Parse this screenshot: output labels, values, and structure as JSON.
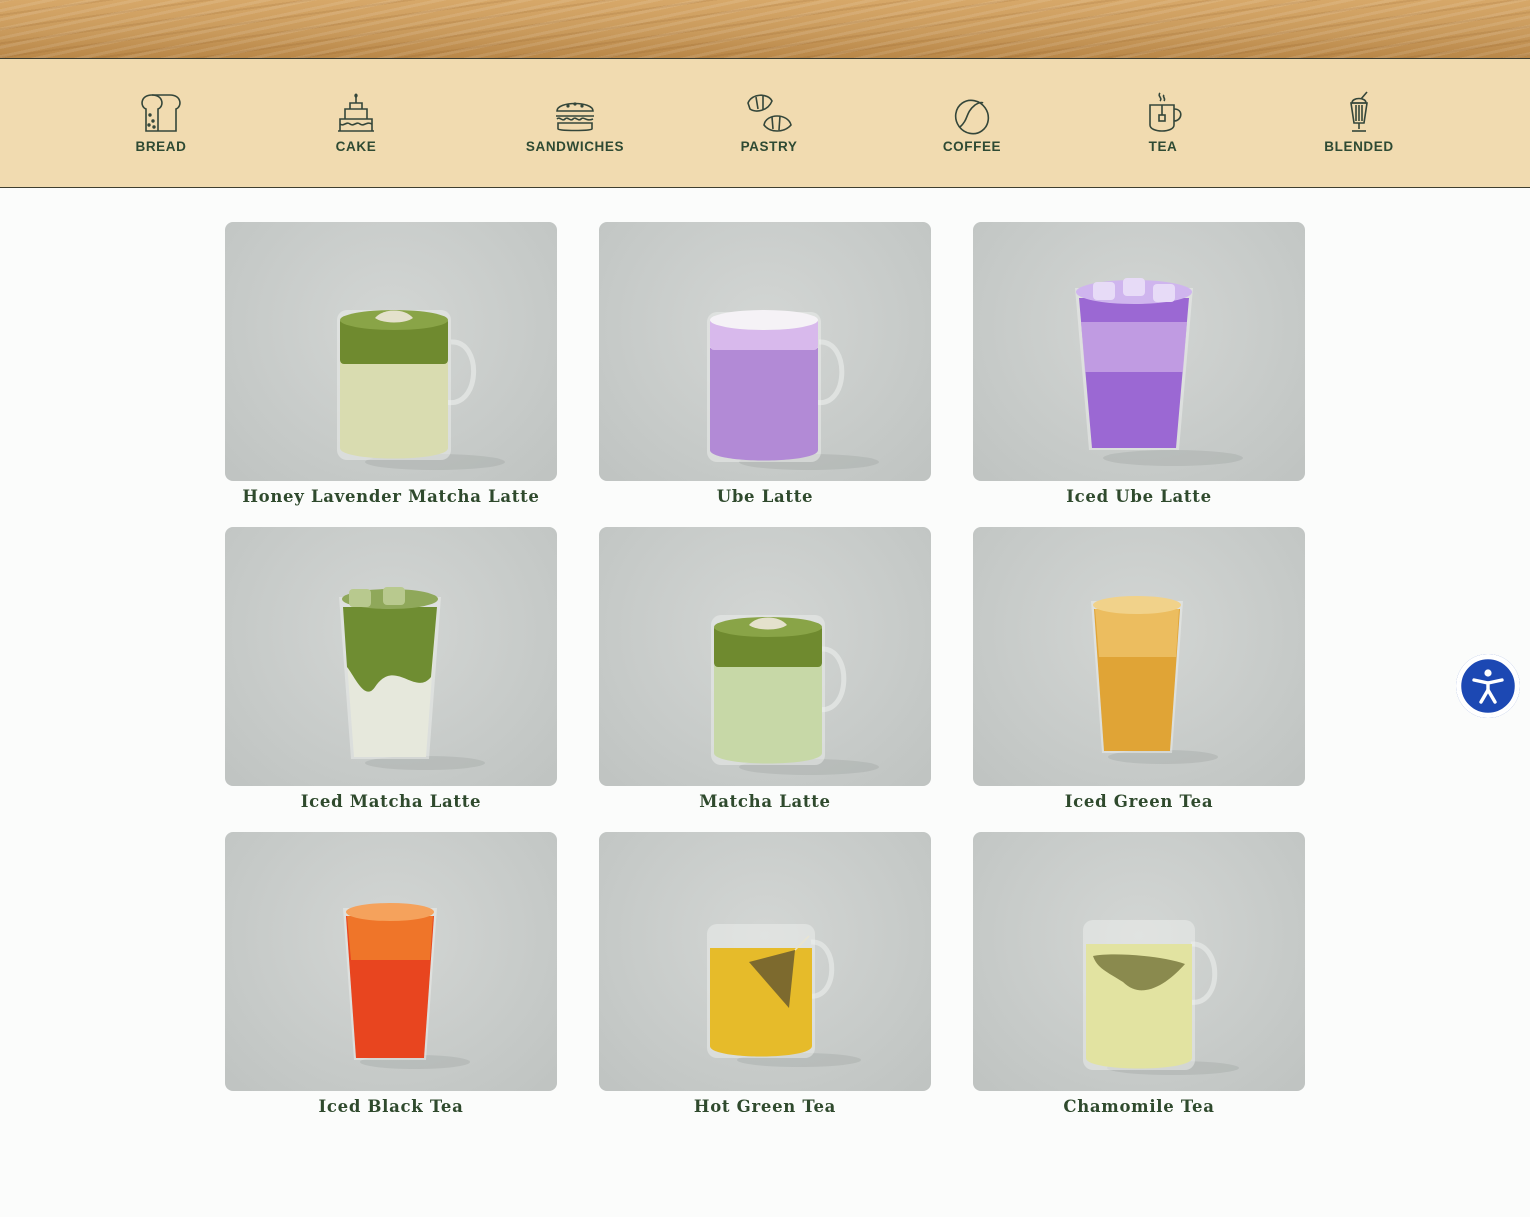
{
  "categories": [
    {
      "label": "BREAD",
      "icon": "bread-icon"
    },
    {
      "label": "CAKE",
      "icon": "cake-icon"
    },
    {
      "label": "SANDWICHES",
      "icon": "sandwich-icon"
    },
    {
      "label": "PASTRY",
      "icon": "croissant-icon"
    },
    {
      "label": "COFFEE",
      "icon": "coffee-bean-icon"
    },
    {
      "label": "TEA",
      "icon": "tea-cup-icon"
    },
    {
      "label": "BLENDED",
      "icon": "blended-drink-icon"
    }
  ],
  "products": [
    {
      "name": "Honey Lavender Matcha Latte"
    },
    {
      "name": "Ube Latte"
    },
    {
      "name": "Iced Ube Latte"
    },
    {
      "name": "Iced Matcha Latte"
    },
    {
      "name": "Matcha Latte"
    },
    {
      "name": "Iced Green Tea"
    },
    {
      "name": "Iced Black Tea"
    },
    {
      "name": "Hot Green Tea"
    },
    {
      "name": "Chamomile Tea"
    }
  ],
  "colors": {
    "category_bar": "#f1dbb0",
    "label_green": "#2e4a33",
    "accessibility_blue": "#1c48b3"
  },
  "accessibility": {
    "icon": "accessibility-person-icon"
  }
}
